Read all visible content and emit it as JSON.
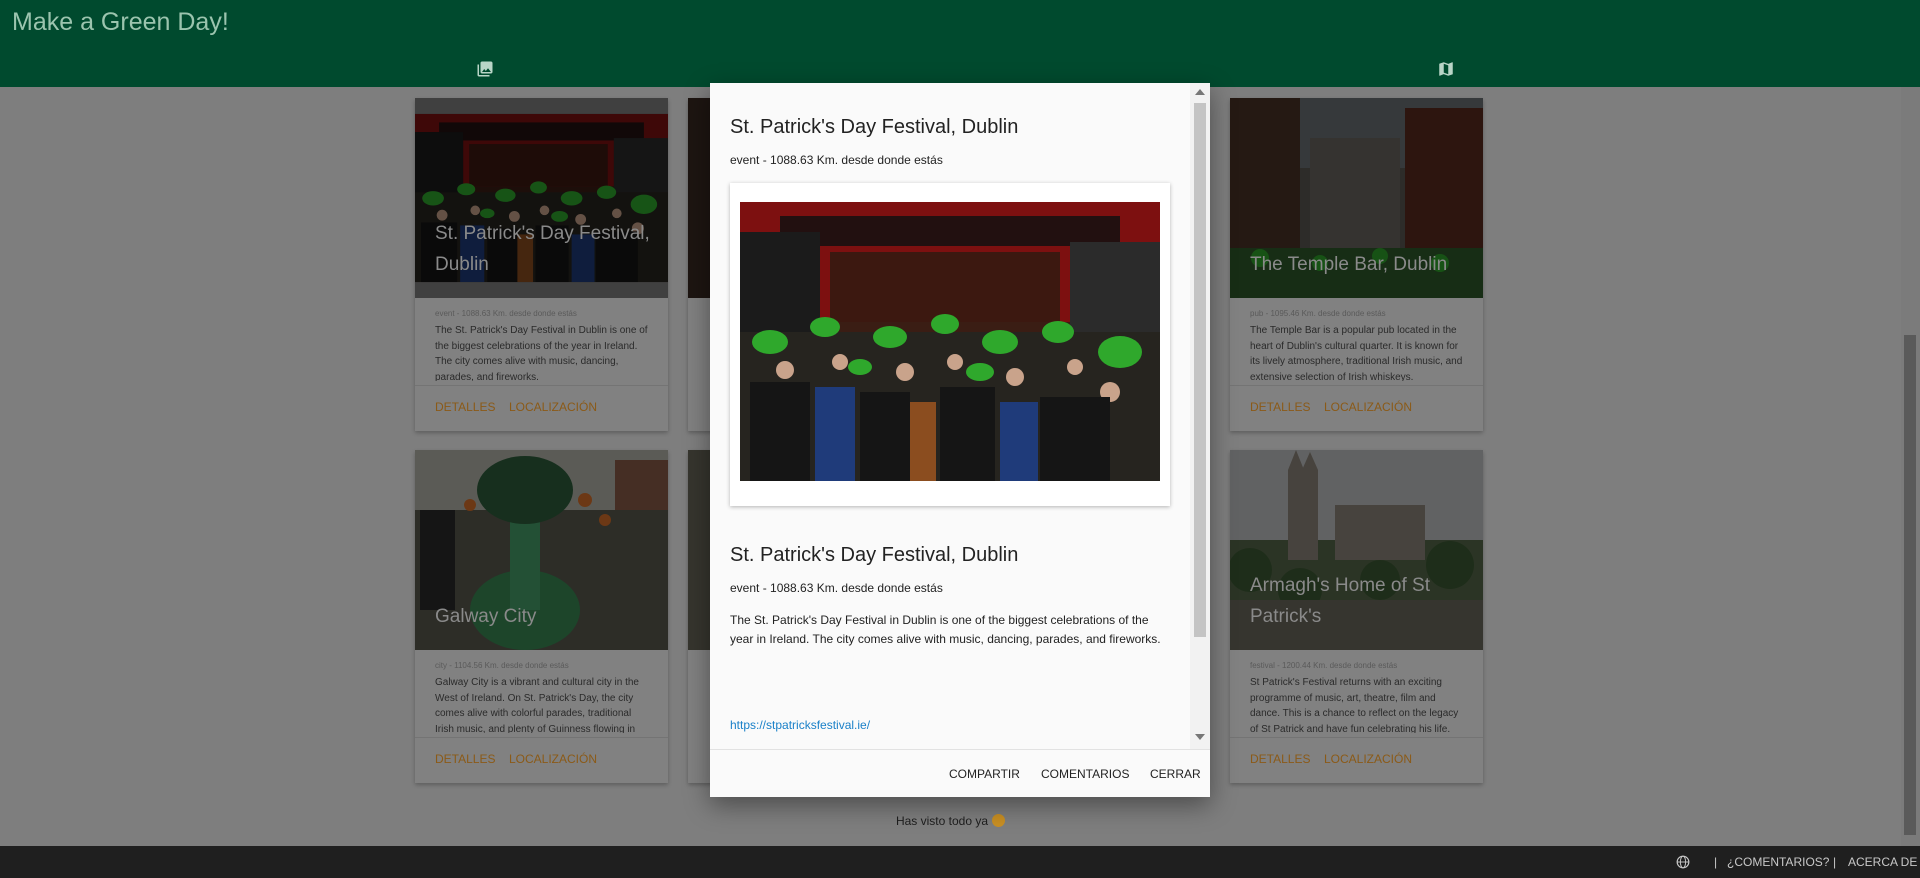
{
  "header": {
    "title": "Make a Green Day!",
    "tabs": [
      {
        "icon": "photo-library-icon"
      },
      {
        "icon": "map-icon"
      }
    ]
  },
  "cards": [
    {
      "title": "St. Patrick's Day Festival, Dublin",
      "subtitle": "event - 1088.63 Km. desde donde estás",
      "description": "The St. Patrick's Day Festival in Dublin is one of the biggest celebrations of the year in Ireland. The city comes alive with music, dancing, parades, and fireworks.",
      "details_label": "DETALLES",
      "location_label": "LOCALIZACIÓN"
    },
    {
      "title": "The Temple Bar, Dublin",
      "subtitle": "pub - 1095.46 Km. desde donde estás",
      "description": "The Temple Bar is a popular pub located in the heart of Dublin's cultural quarter. It is known for its lively atmosphere, traditional Irish music, and extensive selection of Irish whiskeys.",
      "details_label": "DETALLES",
      "location_label": "LOCALIZACIÓN"
    },
    {
      "title": "Galway City",
      "subtitle": "city - 1104.56 Km. desde donde estás",
      "description": "Galway City is a vibrant and cultural city in the West of Ireland. On St. Patrick's Day, the city comes alive with colorful parades, traditional Irish music, and plenty of Guinness flowing in the pubs.",
      "details_label": "DETALLES",
      "location_label": "LOCALIZACIÓN"
    },
    {
      "title": "Armagh's Home of St Patrick's",
      "subtitle": "festival - 1200.44 Km. desde donde estás",
      "description": "St Patrick's Festival returns with an exciting programme of music, art, theatre, film and dance. This is a chance to reflect on the legacy of St Patrick and have fun celebrating his life.",
      "details_label": "DETALLES",
      "location_label": "LOCALIZACIÓN"
    }
  ],
  "footer": {
    "end_text": "Has visto todo ya",
    "language_icon": "globe-icon",
    "separator": "|",
    "feedback_label": "¿COMENTARIOS?",
    "about_label": "ACERCA DE"
  },
  "modal": {
    "title": "St. Patrick's Day Festival, Dublin",
    "subtitle": "event - 1088.63 Km. desde donde estás",
    "title_repeat": "St. Patrick's Day Festival, Dublin",
    "subtitle_repeat": "event - 1088.63 Km. desde donde estás",
    "description": "The St. Patrick's Day Festival in Dublin is one of the biggest celebrations of the year in Ireland. The city comes alive with music, dancing, parades, and fireworks.",
    "link": "https://stpatricksfestival.ie/",
    "actions": {
      "share": "COMPARTIR",
      "comments": "COMENTARIOS",
      "close": "CERRAR"
    }
  },
  "colors": {
    "header_bg": "#004a2e",
    "accent_button": "#8b5a17",
    "link": "#1a80c8",
    "bottom_bar": "#1f1f1f"
  }
}
